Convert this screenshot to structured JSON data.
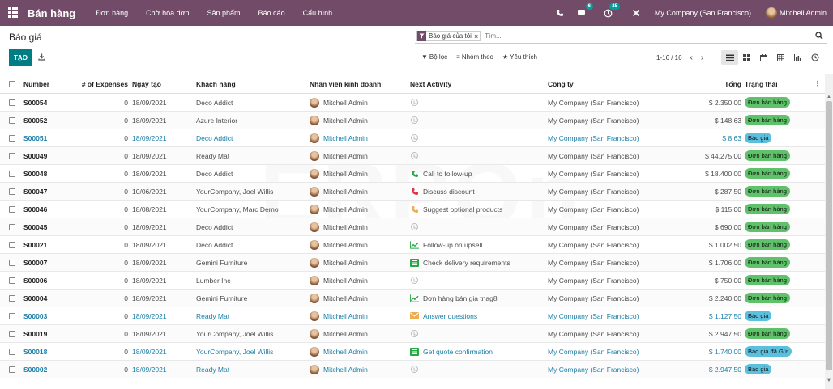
{
  "nav": {
    "app_name": "Bán hàng",
    "menu": [
      "Đơn hàng",
      "Chờ hóa đơn",
      "Sản phẩm",
      "Báo cáo",
      "Cấu hình"
    ],
    "messages_badge": "6",
    "activities_badge": "25",
    "company": "My Company (San Francisco)",
    "user": "Mitchell Admin",
    "brand_color": "#714B67"
  },
  "control": {
    "title": "Báo giá",
    "create_label": "TẠO",
    "facet_label": "Báo giá của tôi",
    "search_placeholder": "Tìm...",
    "filter_label": "Bộ lọc",
    "groupby_label": "Nhóm theo",
    "favorites_label": "Yêu thích",
    "pager": "1-16 / 16"
  },
  "columns": {
    "number": "Number",
    "expenses": "# of Expenses",
    "date": "Ngày tạo",
    "customer": "Khách hàng",
    "salesperson": "Nhân viên kinh doanh",
    "activity": "Next Activity",
    "company": "Công ty",
    "total": "Tổng",
    "status": "Trạng thái"
  },
  "rows": [
    {
      "number": "S00054",
      "expenses": "0",
      "date": "18/09/2021",
      "customer": "Deco Addict",
      "salesperson": "Mitchell Admin",
      "activity": "",
      "activity_icon": "",
      "company": "My Company (San Francisco)",
      "total": "$ 2.350,00",
      "status": "Đơn bán hàng",
      "status_type": "green",
      "highlight": false
    },
    {
      "number": "S00052",
      "expenses": "0",
      "date": "18/09/2021",
      "customer": "Azure Interior",
      "salesperson": "Mitchell Admin",
      "activity": "",
      "activity_icon": "",
      "company": "My Company (San Francisco)",
      "total": "$ 148,63",
      "status": "Đơn bán hàng",
      "status_type": "green",
      "highlight": false
    },
    {
      "number": "S00051",
      "expenses": "0",
      "date": "18/09/2021",
      "customer": "Deco Addict",
      "salesperson": "Mitchell Admin",
      "activity": "",
      "activity_icon": "",
      "company": "My Company (San Francisco)",
      "total": "$ 8,63",
      "status": "Báo giá",
      "status_type": "blue",
      "highlight": true
    },
    {
      "number": "S00049",
      "expenses": "0",
      "date": "18/09/2021",
      "customer": "Ready Mat",
      "salesperson": "Mitchell Admin",
      "activity": "",
      "activity_icon": "",
      "company": "My Company (San Francisco)",
      "total": "$ 44.275,00",
      "status": "Đơn bán hàng",
      "status_type": "green",
      "highlight": false
    },
    {
      "number": "S00048",
      "expenses": "0",
      "date": "18/09/2021",
      "customer": "Deco Addict",
      "salesperson": "Mitchell Admin",
      "activity": "Call to follow-up",
      "activity_icon": "phone-green",
      "company": "My Company (San Francisco)",
      "total": "$ 18.400,00",
      "status": "Đơn bán hàng",
      "status_type": "green",
      "highlight": false
    },
    {
      "number": "S00047",
      "expenses": "0",
      "date": "10/06/2021",
      "customer": "YourCompany, Joel Willis",
      "salesperson": "Mitchell Admin",
      "activity": "Discuss discount",
      "activity_icon": "phone-red",
      "company": "My Company (San Francisco)",
      "total": "$ 287,50",
      "status": "Đơn bán hàng",
      "status_type": "green",
      "highlight": false
    },
    {
      "number": "S00046",
      "expenses": "0",
      "date": "18/08/2021",
      "customer": "YourCompany, Marc Demo",
      "salesperson": "Mitchell Admin",
      "activity": "Suggest optional products",
      "activity_icon": "phone-orange",
      "company": "My Company (San Francisco)",
      "total": "$ 115,00",
      "status": "Đơn bán hàng",
      "status_type": "green",
      "highlight": false
    },
    {
      "number": "S00045",
      "expenses": "0",
      "date": "18/09/2021",
      "customer": "Deco Addict",
      "salesperson": "Mitchell Admin",
      "activity": "",
      "activity_icon": "",
      "company": "My Company (San Francisco)",
      "total": "$ 690,00",
      "status": "Đơn bán hàng",
      "status_type": "green",
      "highlight": false
    },
    {
      "number": "S00021",
      "expenses": "0",
      "date": "18/09/2021",
      "customer": "Deco Addict",
      "salesperson": "Mitchell Admin",
      "activity": "Follow-up on upsell",
      "activity_icon": "chart-green",
      "company": "My Company (San Francisco)",
      "total": "$ 1.002,50",
      "status": "Đơn bán hàng",
      "status_type": "green",
      "highlight": false
    },
    {
      "number": "S00007",
      "expenses": "0",
      "date": "18/09/2021",
      "customer": "Gemini Furniture",
      "salesperson": "Mitchell Admin",
      "activity": "Check delivery requirements",
      "activity_icon": "tasks-green",
      "company": "My Company (San Francisco)",
      "total": "$ 1.706,00",
      "status": "Đơn bán hàng",
      "status_type": "green",
      "highlight": false
    },
    {
      "number": "S00006",
      "expenses": "0",
      "date": "18/09/2021",
      "customer": "Lumber Inc",
      "salesperson": "Mitchell Admin",
      "activity": "",
      "activity_icon": "",
      "company": "My Company (San Francisco)",
      "total": "$ 750,00",
      "status": "Đơn bán hàng",
      "status_type": "green",
      "highlight": false
    },
    {
      "number": "S00004",
      "expenses": "0",
      "date": "18/09/2021",
      "customer": "Gemini Furniture",
      "salesperson": "Mitchell Admin",
      "activity": "Đơn hàng bán gia tnag8",
      "activity_icon": "chart-green",
      "company": "My Company (San Francisco)",
      "total": "$ 2.240,00",
      "status": "Đơn bán hàng",
      "status_type": "green",
      "highlight": false
    },
    {
      "number": "S00003",
      "expenses": "0",
      "date": "18/09/2021",
      "customer": "Ready Mat",
      "salesperson": "Mitchell Admin",
      "activity": "Answer questions",
      "activity_icon": "envelope-orange",
      "company": "My Company (San Francisco)",
      "total": "$ 1.127,50",
      "status": "Báo giá",
      "status_type": "blue",
      "highlight": true
    },
    {
      "number": "S00019",
      "expenses": "0",
      "date": "18/09/2021",
      "customer": "YourCompany, Joel Willis",
      "salesperson": "Mitchell Admin",
      "activity": "",
      "activity_icon": "",
      "company": "My Company (San Francisco)",
      "total": "$ 2.947,50",
      "status": "Đơn bán hàng",
      "status_type": "green",
      "highlight": false
    },
    {
      "number": "S00018",
      "expenses": "0",
      "date": "18/09/2021",
      "customer": "YourCompany, Joel Willis",
      "salesperson": "Mitchell Admin",
      "activity": "Get quote confirmation",
      "activity_icon": "tasks-green",
      "company": "My Company (San Francisco)",
      "total": "$ 1.740,00",
      "status": "Báo giá đã Gửi",
      "status_type": "blue",
      "highlight": true
    },
    {
      "number": "S00002",
      "expenses": "0",
      "date": "18/09/2021",
      "customer": "Ready Mat",
      "salesperson": "Mitchell Admin",
      "activity": "",
      "activity_icon": "",
      "company": "My Company (San Francisco)",
      "total": "$ 2.947,50",
      "status": "Báo giá",
      "status_type": "blue",
      "highlight": true
    }
  ],
  "watermark": "ERPOn",
  "colors": {
    "primary": "#017e84",
    "status_green": "#5fc26a",
    "status_blue": "#5bc0de",
    "link_blue": "#1a7fa8"
  }
}
